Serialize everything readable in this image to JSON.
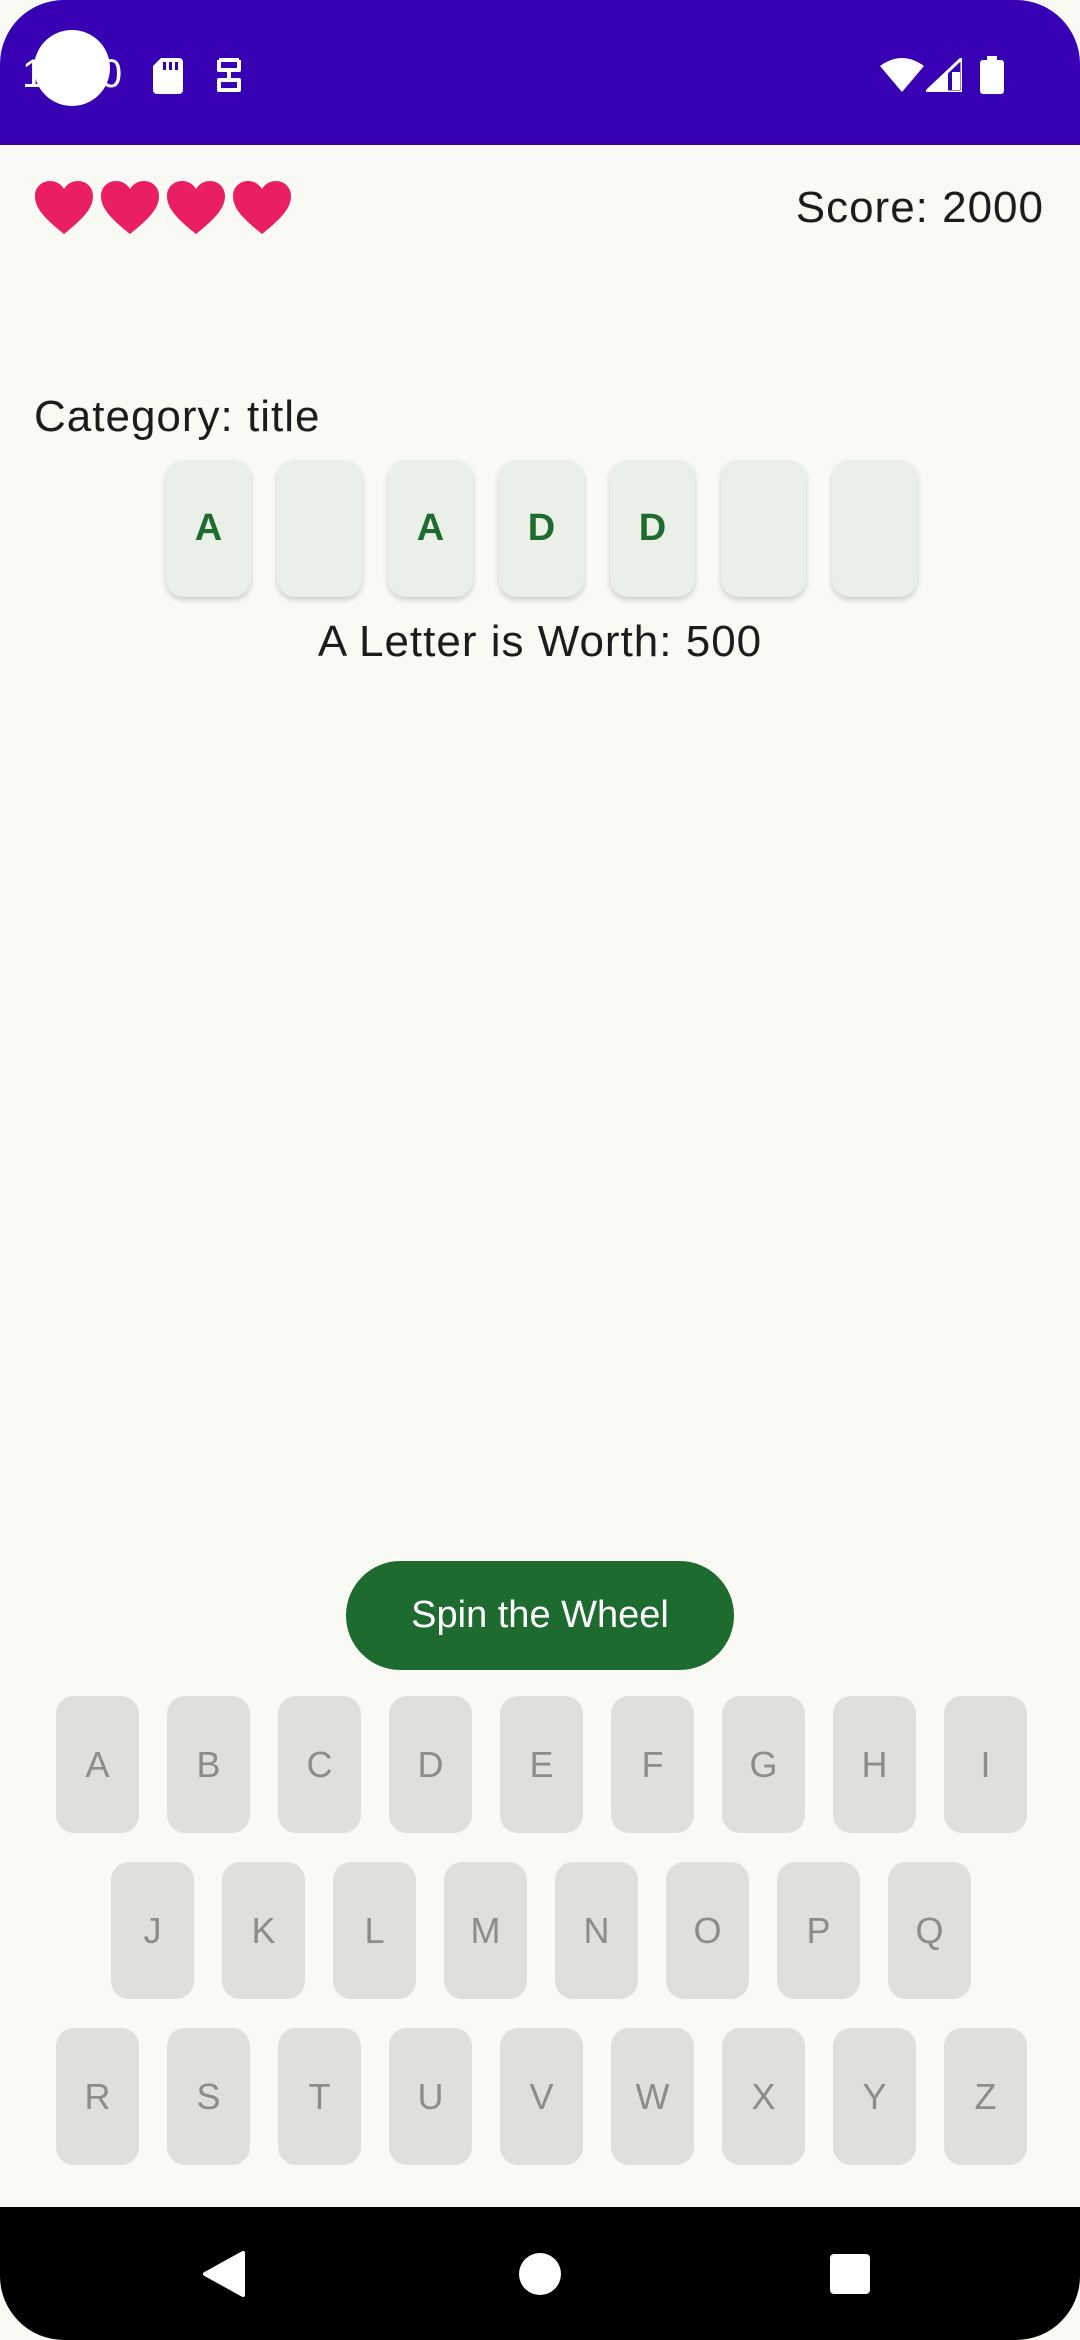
{
  "status_bar": {
    "time": "10:00",
    "icons": [
      "sd-card-icon",
      "cast-icon",
      "wifi-icon",
      "signal-icon",
      "battery-icon"
    ]
  },
  "game": {
    "lives": 4,
    "score_text": "Score: 2000",
    "category_text": "Category: title",
    "tiles": [
      "A",
      "",
      "A",
      "D",
      "D",
      "",
      ""
    ],
    "worth_text": "A Letter is Worth: 500"
  },
  "spin_button_label": "Spin the Wheel",
  "keyboard": {
    "row1": [
      "A",
      "B",
      "C",
      "D",
      "E",
      "F",
      "G",
      "H",
      "I"
    ],
    "row2": [
      "J",
      "K",
      "L",
      "M",
      "N",
      "O",
      "P",
      "Q"
    ],
    "row3": [
      "R",
      "S",
      "T",
      "U",
      "V",
      "W",
      "X",
      "Y",
      "Z"
    ]
  },
  "colors": {
    "status_bar": "#3700b3",
    "accent": "#1e6b30",
    "heart": "#e91e63",
    "key_bg": "#dfdfdb",
    "tile_bg": "#eaf0e8"
  }
}
